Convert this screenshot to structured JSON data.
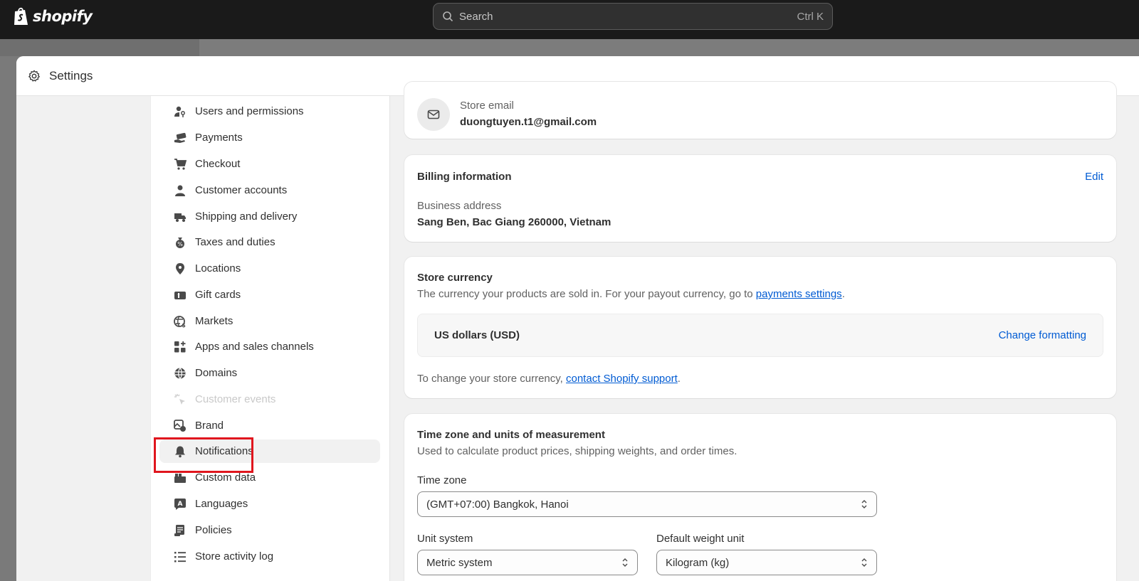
{
  "topbar": {
    "logo_text": "shopify",
    "search_placeholder": "Search",
    "search_shortcut": "Ctrl K"
  },
  "modal": {
    "title": "Settings"
  },
  "sidebar": {
    "items": [
      {
        "label": "Users and permissions",
        "icon": "user-key-icon"
      },
      {
        "label": "Payments",
        "icon": "hand-card-icon"
      },
      {
        "label": "Checkout",
        "icon": "cart-icon"
      },
      {
        "label": "Customer accounts",
        "icon": "person-icon"
      },
      {
        "label": "Shipping and delivery",
        "icon": "truck-icon"
      },
      {
        "label": "Taxes and duties",
        "icon": "tax-bag-icon"
      },
      {
        "label": "Locations",
        "icon": "location-pin-icon"
      },
      {
        "label": "Gift cards",
        "icon": "gift-card-icon"
      },
      {
        "label": "Markets",
        "icon": "globe-dollar-icon"
      },
      {
        "label": "Apps and sales channels",
        "icon": "apps-icon"
      },
      {
        "label": "Domains",
        "icon": "globe-icon"
      },
      {
        "label": "Customer events",
        "icon": "cursor-sparkle-icon",
        "disabled": true
      },
      {
        "label": "Brand",
        "icon": "brand-icon"
      },
      {
        "label": "Notifications",
        "icon": "bell-icon",
        "active": true
      },
      {
        "label": "Custom data",
        "icon": "database-icon"
      },
      {
        "label": "Languages",
        "icon": "language-icon"
      },
      {
        "label": "Policies",
        "icon": "policy-icon"
      },
      {
        "label": "Store activity log",
        "icon": "list-icon"
      }
    ]
  },
  "store_email": {
    "label": "Store email",
    "value": "duongtuyen.t1@gmail.com"
  },
  "billing": {
    "title": "Billing information",
    "edit": "Edit",
    "address_label": "Business address",
    "address_value": "Sang Ben, Bac Giang 260000, Vietnam"
  },
  "currency": {
    "title": "Store currency",
    "desc_prefix": "The currency your products are sold in. For your payout currency, go to ",
    "desc_link": "payments settings",
    "desc_suffix": ".",
    "value": "US dollars (USD)",
    "change_formatting": "Change formatting",
    "note_prefix": "To change your store currency, ",
    "note_link": "contact Shopify support",
    "note_suffix": "."
  },
  "timezone": {
    "title": "Time zone and units of measurement",
    "desc": "Used to calculate product prices, shipping weights, and order times.",
    "tz_label": "Time zone",
    "tz_value": "(GMT+07:00) Bangkok, Hanoi",
    "unit_label": "Unit system",
    "unit_value": "Metric system",
    "weight_label": "Default weight unit",
    "weight_value": "Kilogram (kg)"
  },
  "colors": {
    "topbar": "#1a1a1a",
    "link": "#005bd3",
    "highlight": "#e0161e"
  }
}
